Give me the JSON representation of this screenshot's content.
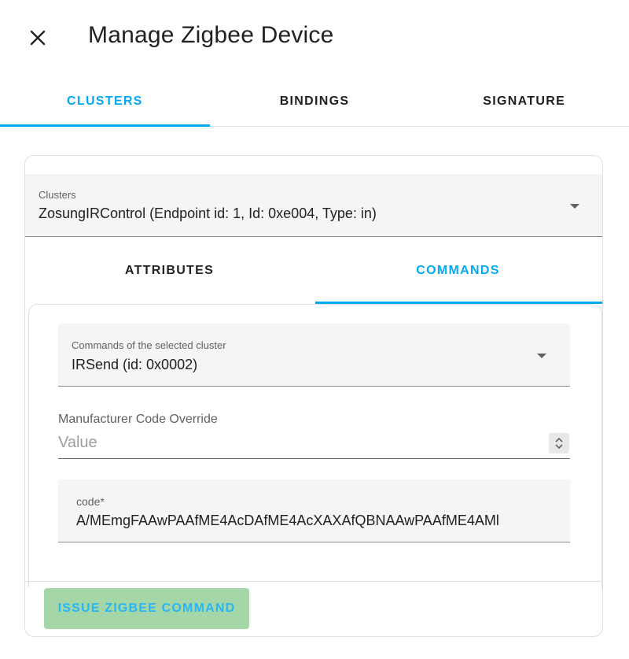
{
  "dialog": {
    "title": "Manage Zigbee Device"
  },
  "tabs": [
    {
      "label": "CLUSTERS",
      "active": true
    },
    {
      "label": "BINDINGS",
      "active": false
    },
    {
      "label": "SIGNATURE",
      "active": false
    }
  ],
  "clusters_select": {
    "label": "Clusters",
    "value": "ZosungIRControl (Endpoint id: 1, Id: 0xe004, Type: in)"
  },
  "subtabs": [
    {
      "label": "ATTRIBUTES",
      "active": false
    },
    {
      "label": "COMMANDS",
      "active": true
    }
  ],
  "commands_select": {
    "label": "Commands of the selected cluster",
    "value": "IRSend (id: 0x0002)"
  },
  "manufacturer_override": {
    "label": "Manufacturer Code Override",
    "placeholder": "Value",
    "value": ""
  },
  "code_field": {
    "label": "code*",
    "value": "A/MEmgFAAwPAAfME4AcDAfME4AcXAXAfQBNAAwPAAfME4AMl"
  },
  "actions": {
    "issue_label": "ISSUE ZIGBEE COMMAND"
  },
  "colors": {
    "accent": "#03a9f4",
    "button_bg": "#a5d6a7",
    "field_bg": "#f5f5f5"
  },
  "icons": {
    "close": "close-icon",
    "dropdown": "caret-down-icon",
    "spinner": "spinner-updown-icon"
  }
}
